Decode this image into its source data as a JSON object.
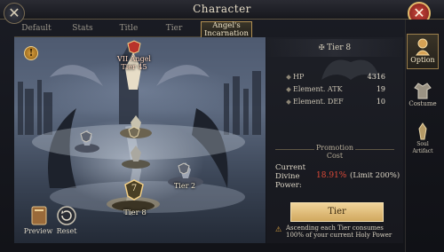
{
  "window": {
    "title": "Character"
  },
  "tabs": [
    {
      "label": "Default"
    },
    {
      "label": "Stats"
    },
    {
      "label": "Title"
    },
    {
      "label": "Tier"
    },
    {
      "label": "Angel's Incarnation",
      "active": true
    }
  ],
  "scene": {
    "nodes": [
      {
        "label": "VII Angel",
        "sublabel": "Tier 45",
        "highlight": true
      },
      {
        "label": "Tier 8",
        "selected": true,
        "badge": "7"
      },
      {
        "label": "Tier 2"
      }
    ],
    "buttons": [
      {
        "label": "Preview",
        "icon": "book-icon"
      },
      {
        "label": "Reset",
        "icon": "reset-icon"
      }
    ]
  },
  "tier_panel": {
    "header": "Tier 8",
    "stats": [
      {
        "name": "HP",
        "value": "4316"
      },
      {
        "name": "Element. ATK",
        "value": "19"
      },
      {
        "name": "Element. DEF",
        "value": "10"
      }
    ],
    "promotion_cost_title_line1": "Promotion",
    "promotion_cost_title_line2": "Cost",
    "divine_power_label_line1": "Current",
    "divine_power_label_line2": "Divine",
    "divine_power_label_line3": "Power:",
    "divine_power_value": "18.91%",
    "divine_power_limit": "(Limit 200%)",
    "action_button": "Tier",
    "note": "Ascending each Tier consumes 100% of your current Holy Power"
  },
  "side_menu": [
    {
      "label": "Option",
      "icon": "option-icon",
      "active": true
    },
    {
      "label": "Costume",
      "icon": "costume-icon"
    },
    {
      "label": "Soul Artifact",
      "icon": "artifact-icon"
    }
  ],
  "colors": {
    "accent_gold": "#d1a85e",
    "danger_red": "#e04a38",
    "frame_dark": "#121318"
  }
}
